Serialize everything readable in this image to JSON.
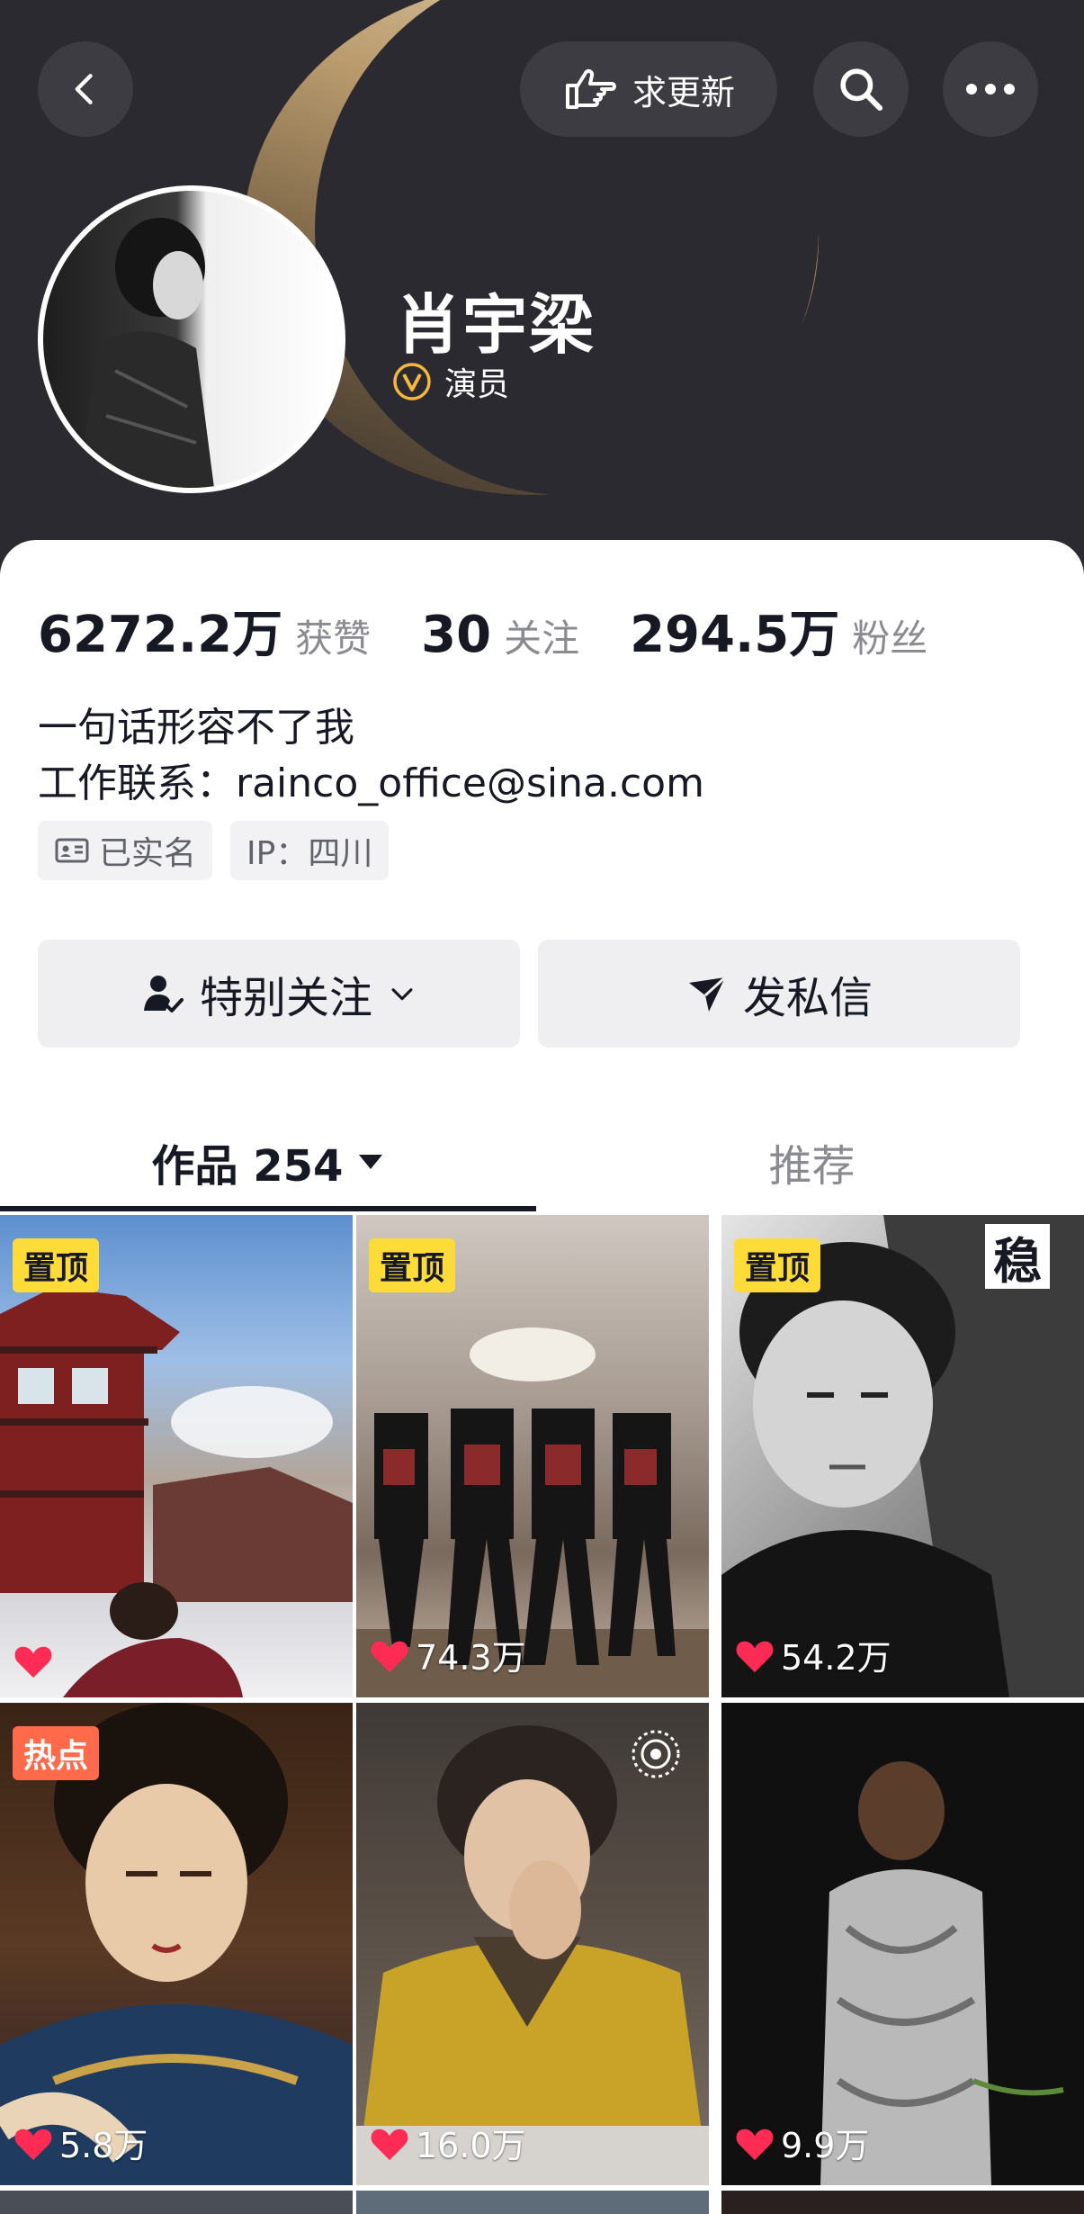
{
  "header": {
    "back_icon": "chevron-left-icon",
    "request_update_label": "求更新",
    "search_icon": "search-icon",
    "more_icon": "more-horizontal-icon"
  },
  "profile": {
    "name": "肖宇梁",
    "verification_label": "演员",
    "verification_icon": "verified-v-icon"
  },
  "stats": [
    {
      "value": "6272.2万",
      "label": "获赞"
    },
    {
      "value": "30",
      "label": "关注"
    },
    {
      "value": "294.5万",
      "label": "粉丝"
    }
  ],
  "bio": {
    "line1": "一句话形容不了我",
    "line2": "工作联系：rainco_office@sina.com"
  },
  "tags": {
    "real_name": "已实名",
    "ip": "IP：四川"
  },
  "actions": {
    "follow_label": "特别关注",
    "message_label": "发私信"
  },
  "tabs": {
    "works_label": "作品 254",
    "recommend_label": "推荐"
  },
  "videos": [
    {
      "badge": "置顶",
      "badge_type": "pin",
      "likes": ""
    },
    {
      "badge": "置顶",
      "badge_type": "pin",
      "likes": "74.3万"
    },
    {
      "badge": "置顶",
      "badge_type": "pin",
      "likes": "54.2万",
      "corner": "稳"
    },
    {
      "badge": "热点",
      "badge_type": "hot",
      "likes": "5.8万"
    },
    {
      "badge": "",
      "badge_type": "",
      "likes": "16.0万"
    },
    {
      "badge": "",
      "badge_type": "",
      "likes": "9.9万"
    }
  ],
  "colors": {
    "header_bg": "#2b2a30",
    "pin_badge": "#fddc3a",
    "hot_badge": "#ff6b4a",
    "like_heart": "#fe2c55",
    "verify_gold": "#f5b83d"
  }
}
